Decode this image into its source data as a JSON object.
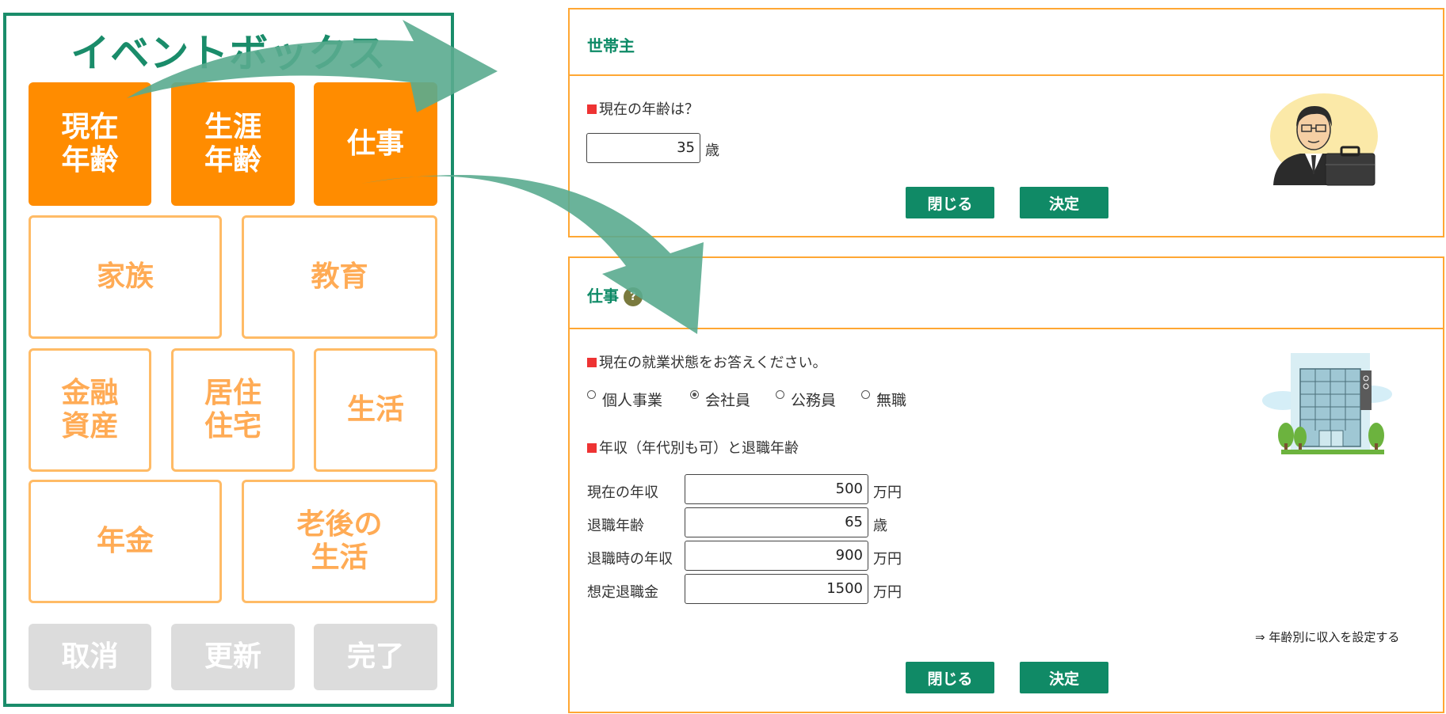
{
  "event_box": {
    "title": "イベントボックス",
    "buttons": {
      "current_age": "現在\n年齢",
      "lifetime_age": "生涯\n年齢",
      "job": "仕事",
      "family": "家族",
      "education": "教育",
      "financial_assets": "金融\n資産",
      "housing": "居住\n住宅",
      "life": "生活",
      "pension": "年金",
      "retirement_life": "老後の\n生活",
      "cancel": "取消",
      "update": "更新",
      "complete": "完了"
    }
  },
  "household_panel": {
    "title": "世帯主",
    "question": "現在の年齢は？",
    "age_value": "35",
    "age_unit": "歳",
    "close_label": "閉じる",
    "decide_label": "決定"
  },
  "job_panel": {
    "title": "仕事",
    "help_glyph": "?",
    "status_question": "現在の就業状態をお答えください。",
    "status_options": [
      "個人事業",
      "会社員",
      "公務員",
      "無職"
    ],
    "status_selected": "会社員",
    "income_question": "年収（年代別も可）と退職年齢",
    "rows": [
      {
        "label": "現在の年収",
        "value": "500",
        "unit": "万円"
      },
      {
        "label": "退職年齢",
        "value": "65",
        "unit": "歳"
      },
      {
        "label": "退職時の年収",
        "value": "900",
        "unit": "万円"
      },
      {
        "label": "想定退職金",
        "value": "1500",
        "unit": "万円"
      }
    ],
    "age_income_link": "⇒ 年齢別に収入を設定する",
    "close_label": "閉じる",
    "decide_label": "決定"
  },
  "colors": {
    "accent_green": "#1a8c6a",
    "button_green": "#108a66",
    "active_orange": "#ff8c00",
    "outline_orange": "#ffbb66",
    "panel_border": "#ffa733",
    "arrow": "#5aab8f"
  }
}
